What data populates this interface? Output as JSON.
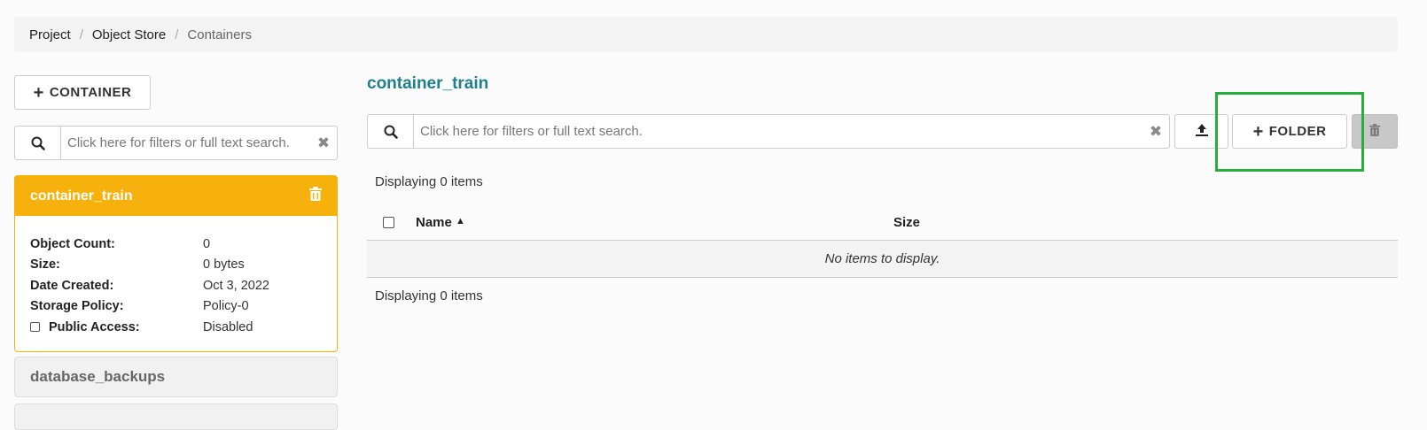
{
  "breadcrumb": [
    "Project",
    "Object Store",
    "Containers"
  ],
  "sidebar": {
    "create_button": "CONTAINER",
    "search_placeholder": "Click here for filters or full text search.",
    "active_container": {
      "name": "container_train",
      "details": [
        {
          "label": "Object Count:",
          "value": "0"
        },
        {
          "label": "Size:",
          "value": "0 bytes"
        },
        {
          "label": "Date Created:",
          "value": "Oct 3, 2022"
        },
        {
          "label": "Storage Policy:",
          "value": "Policy-0"
        },
        {
          "label": "Public Access:",
          "value": "Disabled"
        }
      ]
    },
    "other_containers": [
      "database_backups"
    ]
  },
  "main": {
    "title": "container_train",
    "search_placeholder": "Click here for filters or full text search.",
    "folder_button": "FOLDER",
    "displaying_top": "Displaying 0 items",
    "displaying_bottom": "Displaying 0 items",
    "columns": {
      "name": "Name",
      "size": "Size"
    },
    "empty_message": "No items to display."
  },
  "colors": {
    "accent": "#f7b10d",
    "title": "#1f7f8c",
    "highlight": "#27ae3c"
  },
  "icons": [
    "plus-icon",
    "search-icon",
    "close-icon",
    "trash-icon",
    "upload-icon",
    "sort-asc-icon",
    "checkbox-icon"
  ]
}
